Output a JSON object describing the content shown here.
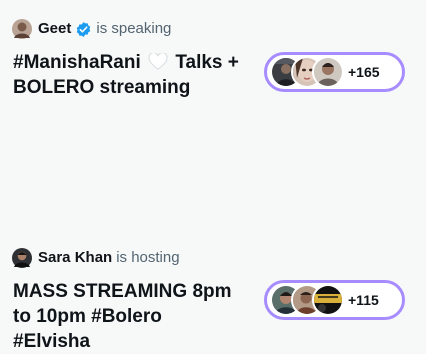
{
  "spaces": [
    {
      "host_name": "Geet",
      "host_status": "is speaking",
      "host_verified": true,
      "title_part1": "#ManishaRani",
      "title_part2": " Talks +",
      "title_part3": "BOLERO streaming",
      "title_emoji": "white-heart-icon",
      "listener_count": "+165"
    },
    {
      "host_name": "Sara Khan",
      "host_status": "is hosting",
      "host_verified": false,
      "title_line1": "MASS STREAMING 8pm",
      "title_line2": "to 10pm #Bolero",
      "title_line3": "#Elvisha",
      "listener_count": "+115"
    }
  ],
  "colors": {
    "background": "#f7f9f9",
    "pill_border": "#a68cff",
    "verified": "#1d9bf0",
    "secondary_text": "#536471"
  }
}
